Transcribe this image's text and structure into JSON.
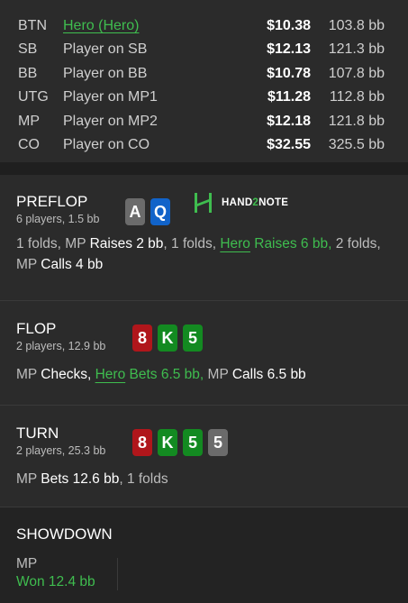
{
  "players": [
    {
      "pos": "BTN",
      "name": "Hero (Hero)",
      "amount": "$10.38",
      "bb": "103.8 bb",
      "hero": true
    },
    {
      "pos": "SB",
      "name": "Player on SB",
      "amount": "$12.13",
      "bb": "121.3 bb",
      "hero": false
    },
    {
      "pos": "BB",
      "name": "Player on BB",
      "amount": "$10.78",
      "bb": "107.8 bb",
      "hero": false
    },
    {
      "pos": "UTG",
      "name": "Player on MP1",
      "amount": "$11.28",
      "bb": "112.8 bb",
      "hero": false
    },
    {
      "pos": "MP",
      "name": "Player on MP2",
      "amount": "$12.18",
      "bb": "121.8 bb",
      "hero": false
    },
    {
      "pos": "CO",
      "name": "Player on CO",
      "amount": "$32.55",
      "bb": "325.5 bb",
      "hero": false
    }
  ],
  "logo": {
    "part1": "HAND",
    "part2": "2",
    "part3": "NOTE"
  },
  "preflop": {
    "title": "PREFLOP",
    "sub": "6 players, 1.5 bb",
    "cards": [
      {
        "rank": "A",
        "color": "#6b6b6b"
      },
      {
        "rank": "Q",
        "color": "#1163c9"
      }
    ],
    "actions": {
      "a1": "1 folds, MP ",
      "a2": "Raises 2 bb",
      ", ": "",
      "a3": ", 1 folds, ",
      "a4": "Hero",
      "a5": " Raises 6 bb,",
      "a6": " 2 folds,",
      "a7": "MP ",
      "a8": "Calls 4 bb"
    }
  },
  "flop": {
    "title": "FLOP",
    "sub": "2 players, 12.9 bb",
    "cards": [
      {
        "rank": "8",
        "color": "#b0161b"
      },
      {
        "rank": "K",
        "color": "#138a21"
      },
      {
        "rank": "5",
        "color": "#138a21"
      }
    ],
    "actions": {
      "a1": "MP ",
      "a2": "Checks",
      ",": ", ",
      "a3": "Hero",
      "a4": " Bets 6.5 bb,",
      "a5": " MP ",
      "a6": "Calls 6.5 bb"
    }
  },
  "turn": {
    "title": "TURN",
    "sub": "2 players, 25.3 bb",
    "cards": [
      {
        "rank": "8",
        "color": "#b0161b"
      },
      {
        "rank": "K",
        "color": "#138a21"
      },
      {
        "rank": "5",
        "color": "#138a21"
      },
      {
        "rank": "5",
        "color": "#6b6b6b"
      }
    ],
    "actions": {
      "a1": "MP ",
      "a2": "Bets 12.6 bb",
      ",": ", 1 folds"
    }
  },
  "showdown": {
    "title": "SHOWDOWN",
    "player": "MP",
    "result": "Won 12.4 bb"
  }
}
